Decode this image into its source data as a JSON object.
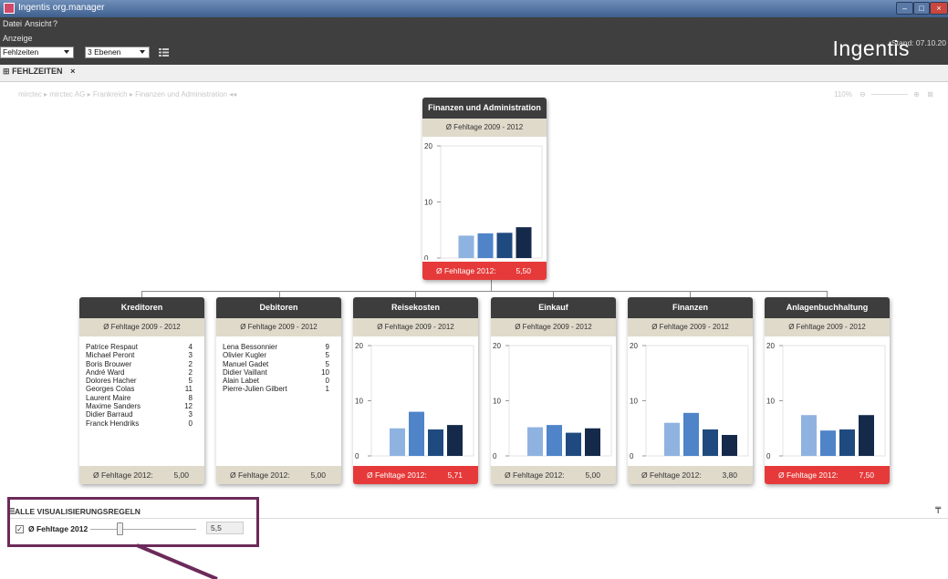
{
  "window": {
    "title": "Ingentis org.manager",
    "controls": [
      "minimize",
      "maximize",
      "close"
    ]
  },
  "menu": {
    "items": [
      "Datei",
      "Ansicht",
      "?"
    ],
    "anzeige_label": "Anzeige"
  },
  "toolbar": {
    "view_select": "Fehlzeiten",
    "levels_select": "3 Ebenen"
  },
  "brand": {
    "logo_text": "Ingentis",
    "stand": "Stand: 07.10.20"
  },
  "tab": {
    "label": "FEHLZEITEN",
    "close": "×"
  },
  "breadcrumb": {
    "text": "mirctec  ▸  mirctec AG  ▸  Frankreich  ▸  Finanzen und Administration  ◂◂"
  },
  "zoom": {
    "level": "110%"
  },
  "colors": {
    "bar1": "#8fb3e0",
    "bar2": "#4f84c9",
    "bar3": "#1f4a80",
    "bar4": "#152a4a",
    "red": "#e63a3a",
    "header": "#3d3d3d",
    "sub": "#e0dacb"
  },
  "footer_label": "Ø Fehltage 2012:",
  "subheader_label": "Ø Fehltage 2009 - 2012",
  "root": {
    "name": "Finanzen und Administration",
    "footer_value": "5,50",
    "footer_red": true,
    "chart": {
      "values": [
        4,
        4.4,
        4.5,
        5.5
      ]
    }
  },
  "units": [
    {
      "name": "Kreditoren",
      "footer_value": "5,00",
      "footer_red": false,
      "people": [
        [
          "Patrice  Respaut",
          "4"
        ],
        [
          "Michael Peront",
          "3"
        ],
        [
          "Boris Brouwer",
          "2"
        ],
        [
          "André Ward",
          "2"
        ],
        [
          "Dolores Hacher",
          "5"
        ],
        [
          "Georges  Colas",
          "11"
        ],
        [
          "Laurent Maire",
          "8"
        ],
        [
          "Maxime Sanders",
          "12"
        ],
        [
          "Didier Barraud",
          "3"
        ],
        [
          "Franck  Hendriks",
          "0"
        ]
      ]
    },
    {
      "name": "Debitoren",
      "footer_value": "5,00",
      "footer_red": false,
      "people": [
        [
          "Lena Bessonnier",
          "9"
        ],
        [
          "Olivier Kugler",
          "5"
        ],
        [
          "Manuel Gadet",
          "5"
        ],
        [
          "Didier Vaillant",
          "10"
        ],
        [
          "Alain Labet",
          "0"
        ],
        [
          "Pierre-Julien Gilbert",
          "1"
        ]
      ]
    },
    {
      "name": "Reisekosten",
      "footer_value": "5,71",
      "footer_red": true,
      "chart": {
        "values": [
          5,
          8,
          4.8,
          5.6
        ]
      }
    },
    {
      "name": "Einkauf",
      "footer_value": "5,00",
      "footer_red": false,
      "chart": {
        "values": [
          5.2,
          5.6,
          4.2,
          5
        ]
      }
    },
    {
      "name": "Finanzen",
      "footer_value": "3,80",
      "footer_red": false,
      "chart": {
        "values": [
          6,
          7.8,
          4.8,
          3.8
        ]
      }
    },
    {
      "name": "Anlagenbuchhaltung",
      "footer_value": "7,50",
      "footer_red": true,
      "chart": {
        "values": [
          7.4,
          4.6,
          4.8,
          7.4
        ]
      }
    }
  ],
  "chart_data": {
    "type": "bar",
    "ylim": [
      0,
      20
    ],
    "yticks": [
      "0",
      "10",
      "20"
    ]
  },
  "rules_panel": {
    "title": "ALLE VISUALISIERUNGSREGELN",
    "rule_label": "Ø Fehltage 2012",
    "checked": "✓",
    "slider_value": "5,5",
    "slider_fraction": 0.27
  }
}
